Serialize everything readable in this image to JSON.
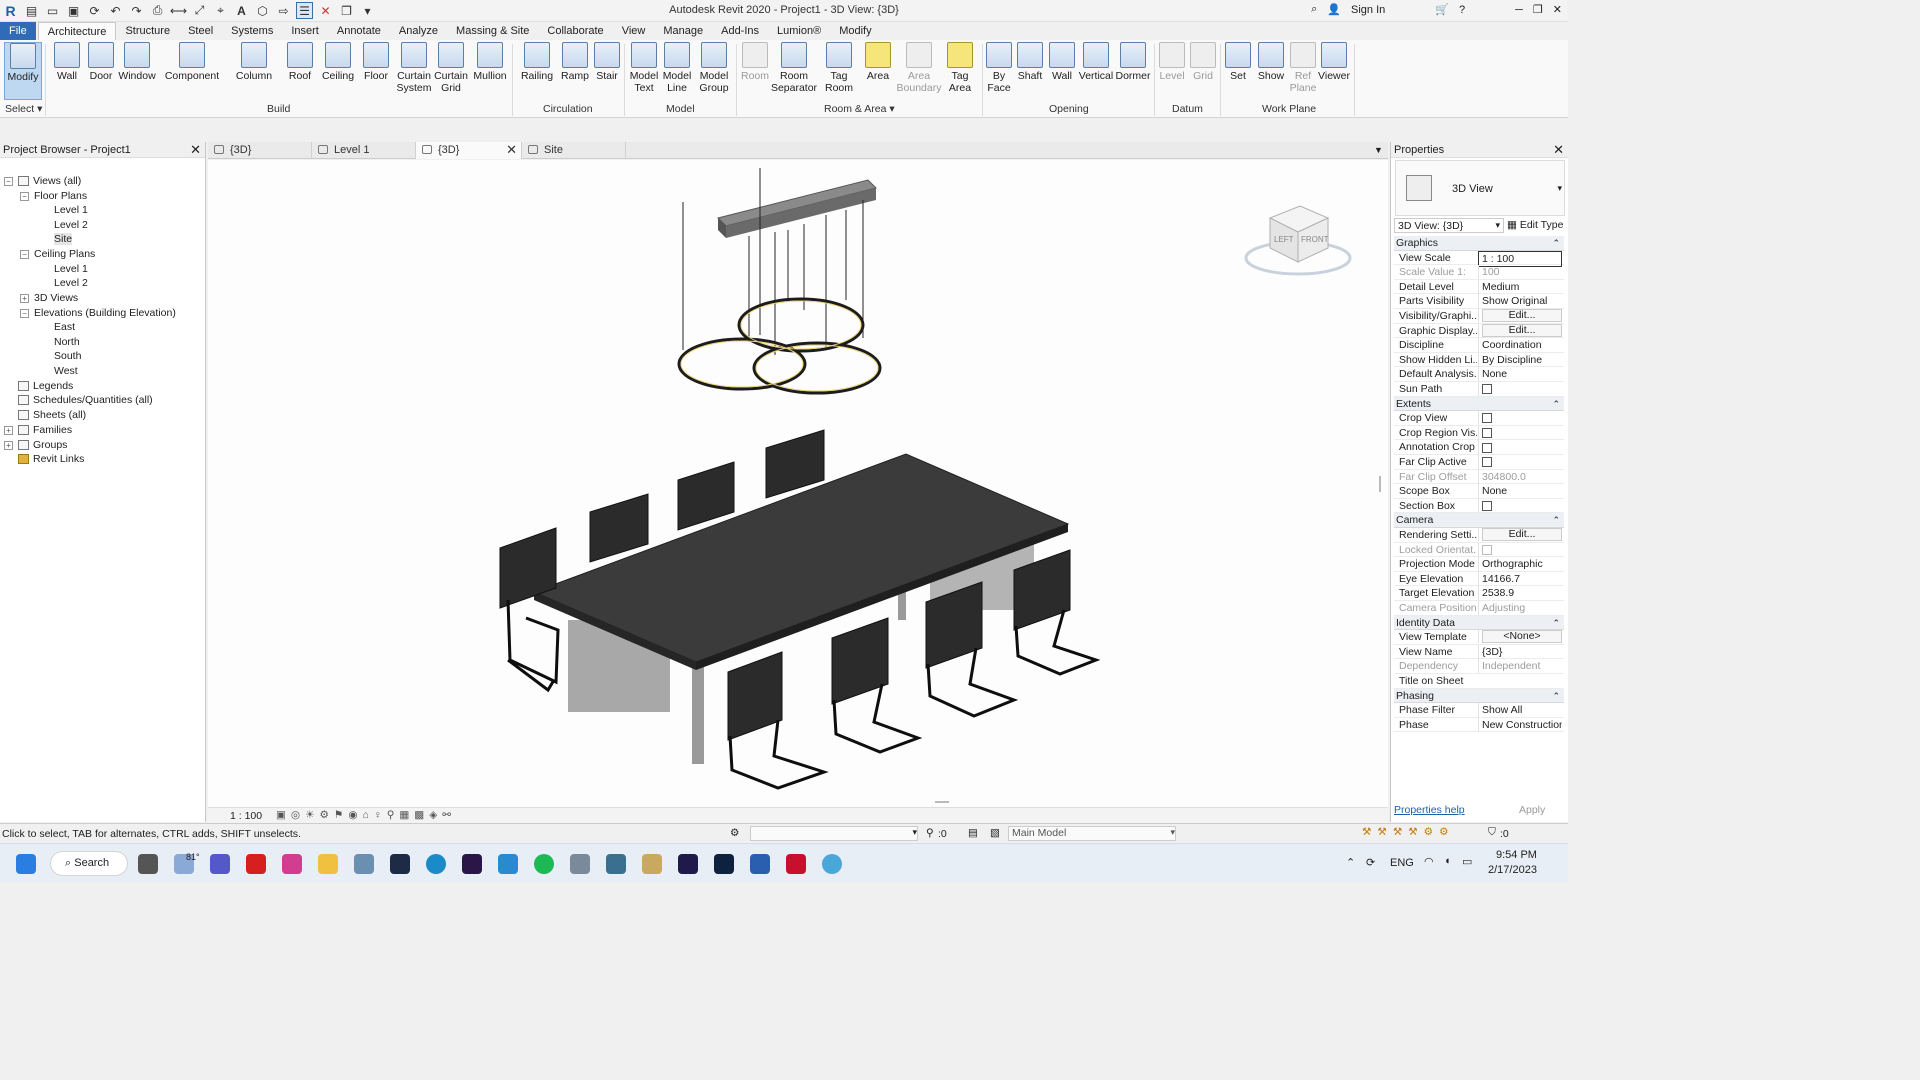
{
  "app": {
    "title": "Autodesk Revit 2020 - Project1 - 3D View: {3D}",
    "sign_in": "Sign In",
    "logo": "R"
  },
  "ribbon_tabs": [
    "File",
    "Architecture",
    "Structure",
    "Steel",
    "Systems",
    "Insert",
    "Annotate",
    "Analyze",
    "Massing & Site",
    "Collaborate",
    "View",
    "Manage",
    "Add-Ins",
    "Lumion®",
    "Modify"
  ],
  "ribbon": {
    "buttons": [
      {
        "label": "Modify"
      },
      {
        "label": "Wall"
      },
      {
        "label": "Door"
      },
      {
        "label": "Window"
      },
      {
        "label": "Component"
      },
      {
        "label": "Column"
      },
      {
        "label": "Roof"
      },
      {
        "label": "Ceiling"
      },
      {
        "label": "Floor"
      },
      {
        "label": "Curtain\nSystem"
      },
      {
        "label": "Curtain\nGrid"
      },
      {
        "label": "Mullion"
      },
      {
        "label": "Railing"
      },
      {
        "label": "Ramp"
      },
      {
        "label": "Stair"
      },
      {
        "label": "Model\nText"
      },
      {
        "label": "Model\nLine"
      },
      {
        "label": "Model\nGroup"
      },
      {
        "label": "Room"
      },
      {
        "label": "Room\nSeparator"
      },
      {
        "label": "Tag\nRoom"
      },
      {
        "label": "Area"
      },
      {
        "label": "Area\nBoundary"
      },
      {
        "label": "Tag\nArea"
      },
      {
        "label": "By\nFace"
      },
      {
        "label": "Shaft"
      },
      {
        "label": "Wall"
      },
      {
        "label": "Vertical"
      },
      {
        "label": "Dormer"
      },
      {
        "label": "Level"
      },
      {
        "label": "Grid"
      },
      {
        "label": "Set"
      },
      {
        "label": "Show"
      },
      {
        "label": "Ref\nPlane"
      },
      {
        "label": "Viewer"
      }
    ],
    "panels": [
      "Select",
      "Build",
      "Circulation",
      "Model",
      "Room & Area",
      "Opening",
      "Datum",
      "Work Plane"
    ]
  },
  "project_browser": {
    "title": "Project Browser - Project1",
    "items": [
      "Views (all)",
      "Floor Plans",
      "Level 1",
      "Level 2",
      "Site",
      "Ceiling Plans",
      "Level 1",
      "Level 2",
      "3D Views",
      "Elevations (Building Elevation)",
      "East",
      "North",
      "South",
      "West",
      "Legends",
      "Schedules/Quantities (all)",
      "Sheets (all)",
      "Families",
      "Groups",
      "Revit Links"
    ]
  },
  "view_tabs": [
    "{3D}",
    "Level 1",
    "{3D}",
    "Site"
  ],
  "viewcube": {
    "left": "LEFT",
    "front": "FRONT"
  },
  "view_control": {
    "scale": "1 : 100"
  },
  "properties": {
    "title": "Properties",
    "type_name": "3D View",
    "instance": "3D View: {3D}",
    "edit_type": "Edit Type",
    "rows": [
      {
        "k": "Graphics",
        "v": "",
        "g": true
      },
      {
        "k": "View Scale",
        "v": "1 : 100"
      },
      {
        "k": "Scale Value    1:",
        "v": "100",
        "d": true
      },
      {
        "k": "Detail Level",
        "v": "Medium"
      },
      {
        "k": "Parts Visibility",
        "v": "Show Original"
      },
      {
        "k": "Visibility/Graphi...",
        "v": "Edit..."
      },
      {
        "k": "Graphic Display...",
        "v": "Edit..."
      },
      {
        "k": "Discipline",
        "v": "Coordination"
      },
      {
        "k": "Show Hidden Li...",
        "v": "By Discipline"
      },
      {
        "k": "Default Analysis...",
        "v": "None"
      },
      {
        "k": "Sun Path",
        "v": ""
      },
      {
        "k": "Extents",
        "v": "",
        "g": true
      },
      {
        "k": "Crop View",
        "v": ""
      },
      {
        "k": "Crop Region Vis...",
        "v": ""
      },
      {
        "k": "Annotation Crop",
        "v": ""
      },
      {
        "k": "Far Clip Active",
        "v": ""
      },
      {
        "k": "Far Clip Offset",
        "v": "304800.0",
        "d": true
      },
      {
        "k": "Scope Box",
        "v": "None"
      },
      {
        "k": "Section Box",
        "v": ""
      },
      {
        "k": "Camera",
        "v": "",
        "g": true
      },
      {
        "k": "Rendering Setti...",
        "v": "Edit..."
      },
      {
        "k": "Locked Orientat...",
        "v": "",
        "d": true
      },
      {
        "k": "Projection Mode",
        "v": "Orthographic"
      },
      {
        "k": "Eye Elevation",
        "v": "14166.7"
      },
      {
        "k": "Target Elevation",
        "v": "2538.9"
      },
      {
        "k": "Camera Position",
        "v": "Adjusting",
        "d": true
      },
      {
        "k": "Identity Data",
        "v": "",
        "g": true
      },
      {
        "k": "View Template",
        "v": "<None>"
      },
      {
        "k": "View Name",
        "v": "{3D}"
      },
      {
        "k": "Dependency",
        "v": "Independent",
        "d": true
      },
      {
        "k": "Title on Sheet",
        "v": ""
      },
      {
        "k": "Phasing",
        "v": "",
        "g": true
      },
      {
        "k": "Phase Filter",
        "v": "Show All"
      },
      {
        "k": "Phase",
        "v": "New Construction"
      }
    ],
    "help": "Properties help",
    "apply": "Apply"
  },
  "status": {
    "hint": "Click to select, TAB for alternates, CTRL adds, SHIFT unselects.",
    "count": ":0",
    "model": "Main Model",
    "filter": ":0"
  },
  "taskbar": {
    "search": "Search",
    "weather": "81°",
    "lang": "ENG",
    "time": "9:54 PM",
    "date": "2/17/2023"
  }
}
